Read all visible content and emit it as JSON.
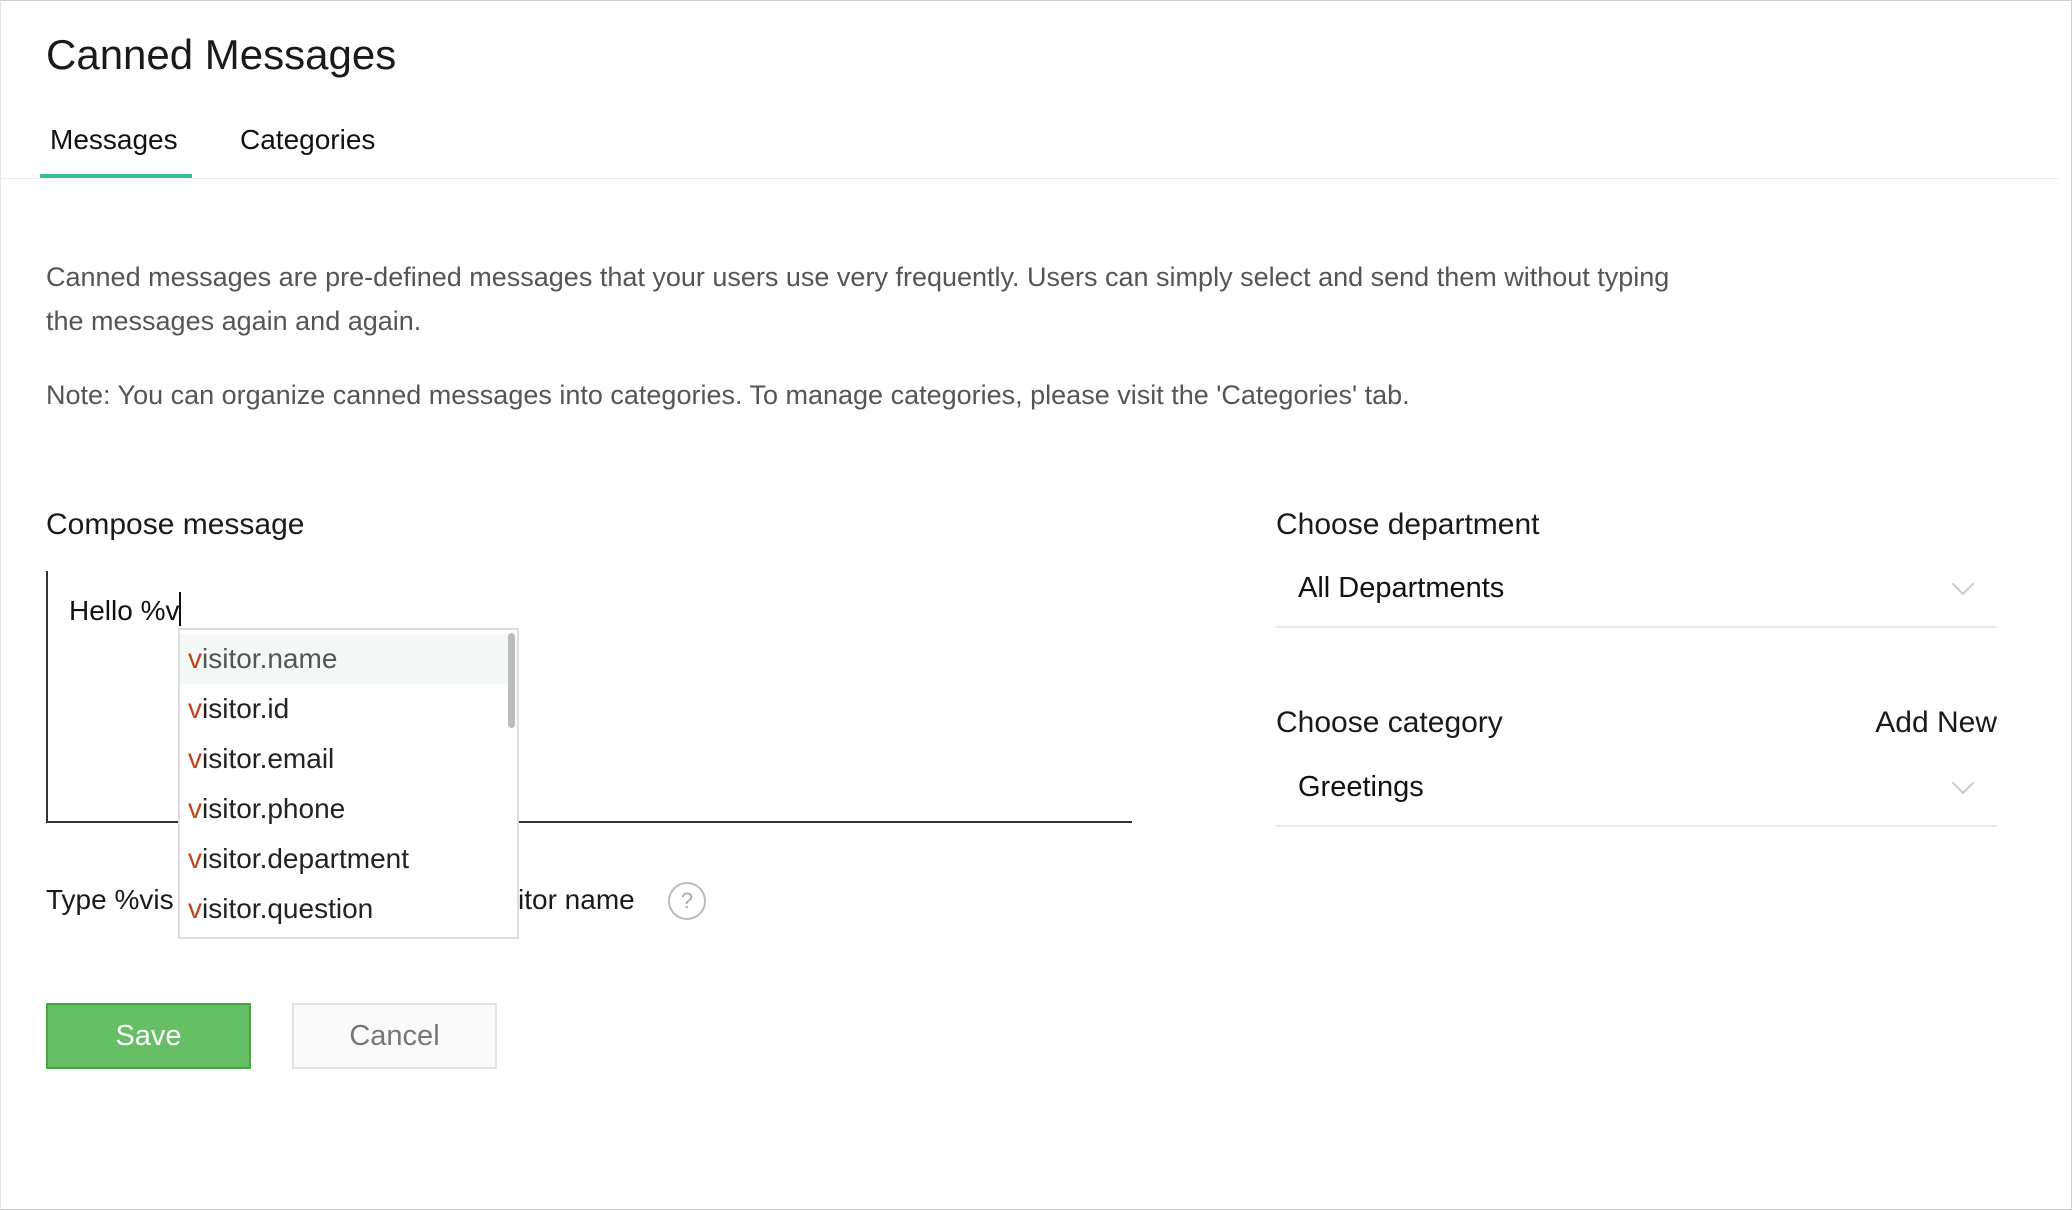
{
  "page": {
    "title": "Canned Messages"
  },
  "tabs": [
    {
      "label": "Messages",
      "active": true
    },
    {
      "label": "Categories",
      "active": false
    }
  ],
  "description": "Canned messages are pre-defined messages that your users use very frequently. Users can simply select and send them without typing the messages again and again.",
  "note": "Note: You can organize canned messages into categories. To manage categories, please visit the 'Categories' tab.",
  "compose": {
    "label": "Compose message",
    "value": "Hello %v",
    "hint_visible_start": "Type %vis",
    "hint_visible_end": "itor name",
    "help_icon": "question-circle-icon",
    "suggestions": [
      {
        "match": "v",
        "rest": "isitor.name"
      },
      {
        "match": "v",
        "rest": "isitor.id"
      },
      {
        "match": "v",
        "rest": "isitor.email"
      },
      {
        "match": "v",
        "rest": "isitor.phone"
      },
      {
        "match": "v",
        "rest": "isitor.department"
      },
      {
        "match": "v",
        "rest": "isitor.question"
      }
    ]
  },
  "department": {
    "label": "Choose department",
    "value": "All Departments"
  },
  "category": {
    "label": "Choose category",
    "add_new": "Add New",
    "value": "Greetings"
  },
  "buttons": {
    "save": "Save",
    "cancel": "Cancel"
  },
  "colors": {
    "accent": "#3dbf8c",
    "save": "#66bf64",
    "match_highlight": "#c0441a"
  }
}
